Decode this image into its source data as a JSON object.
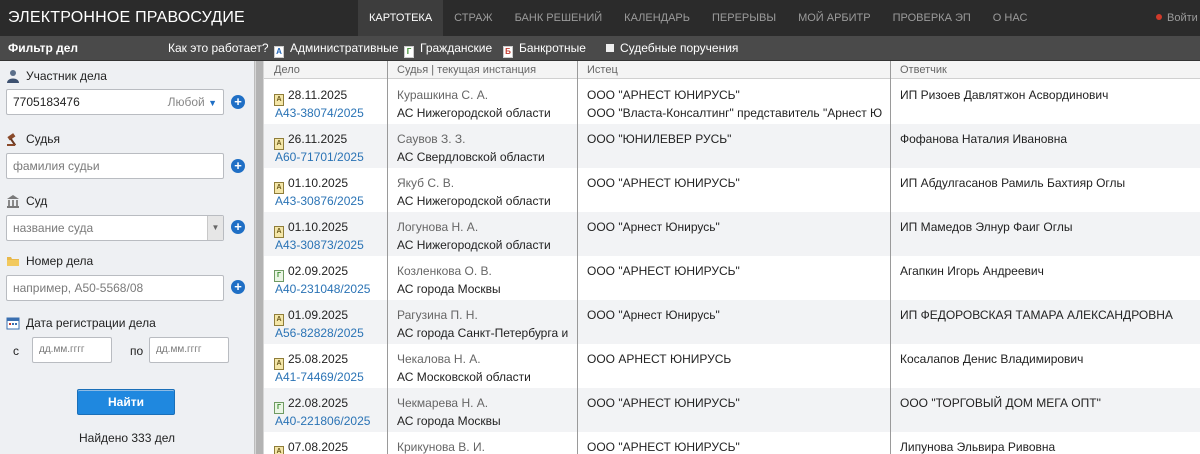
{
  "app": {
    "logo": "ЭЛЕКТРОННОЕ ПРАВОСУДИЕ",
    "nav": [
      "КАРТОТЕКА",
      "СТРАЖ",
      "БАНК РЕШЕНИЙ",
      "КАЛЕНДАРЬ",
      "ПЕРЕРЫВЫ",
      "МОЙ АРБИТР",
      "ПРОВЕРКА ЭП",
      "О НАС"
    ],
    "active_nav": "КАРТОТЕКА",
    "exit_label": "Войти"
  },
  "filterbar": {
    "title": "Фильтр дел",
    "how": "Как это работает?",
    "types": [
      "Административные",
      "Гражданские",
      "Банкротные",
      "Судебные поручения"
    ]
  },
  "sidebar": {
    "participant_label": "Участник дела",
    "participant_value": "7705183476",
    "participant_mode": "Любой",
    "judge_label": "Судья",
    "judge_placeholder": "фамилия судьи",
    "court_label": "Суд",
    "court_placeholder": "название суда",
    "case_number_label": "Номер дела",
    "case_number_placeholder": "например, А50-5568/08",
    "date_label": "Дата регистрации дела",
    "from_label": "с",
    "to_label": "по",
    "date_placeholder": "дд.мм.гггг",
    "find_button": "Найти",
    "found_text": "Найдено 333 дел"
  },
  "table": {
    "columns": [
      "Дело",
      "Судья | текущая инстанция",
      "Истец",
      "Ответчик"
    ],
    "rows": [
      {
        "type": "А",
        "date": "28.11.2025",
        "case": "А43-38074/2025",
        "judge": "Курашкина С. А.",
        "court": "АС Нижегородской области",
        "plaintiff": "ООО \"АРНЕСТ ЮНИРУСЬ\"",
        "plaintiff2": "ООО \"Власта-Консалтинг\" представитель \"Арнест Юнирусь\"",
        "defendant": "ИП Ризоев Давлятжон Асвординович"
      },
      {
        "type": "А",
        "date": "26.11.2025",
        "case": "А60-71701/2025",
        "judge": "Саувов З. З.",
        "court": "АС Свердловской области",
        "plaintiff": "ООО \"ЮНИЛЕВЕР РУСЬ\"",
        "plaintiff2": "",
        "defendant": "Фофанова Наталия Ивановна"
      },
      {
        "type": "А",
        "date": "01.10.2025",
        "case": "А43-30876/2025",
        "judge": "Якуб С. В.",
        "court": "АС Нижегородской области",
        "plaintiff": "ООО \"АРНЕСТ ЮНИРУСЬ\"",
        "plaintiff2": "",
        "defendant": "ИП Абдулгасанов Рамиль Бахтияр Оглы"
      },
      {
        "type": "А",
        "date": "01.10.2025",
        "case": "А43-30873/2025",
        "judge": "Логунова Н. А.",
        "court": "АС Нижегородской области",
        "plaintiff": "ООО \"Арнест Юнирусь\"",
        "plaintiff2": "",
        "defendant": "ИП Мамедов Элнур Фаиг Оглы"
      },
      {
        "type": "Г",
        "date": "02.09.2025",
        "case": "А40-231048/2025",
        "judge": "Козленкова О. В.",
        "court": "АС города Москвы",
        "plaintiff": "ООО \"АРНЕСТ ЮНИРУСЬ\"",
        "plaintiff2": "",
        "defendant": "Агапкин Игорь Андреевич"
      },
      {
        "type": "А",
        "date": "01.09.2025",
        "case": "А56-82828/2025",
        "judge": "Рагузина П. Н.",
        "court": "АС города Санкт-Петербурга и Лен",
        "plaintiff": "ООО \"Арнест Юнирусь\"",
        "plaintiff2": "",
        "defendant": "ИП ФЕДОРОВСКАЯ ТАМАРА АЛЕКСАНДРОВНА"
      },
      {
        "type": "А",
        "date": "25.08.2025",
        "case": "А41-74469/2025",
        "judge": "Чекалова Н. А.",
        "court": "АС Московской области",
        "plaintiff": "ООО АРНЕСТ ЮНИРУСЬ",
        "plaintiff2": "",
        "defendant": "Косалапов Денис Владимирович"
      },
      {
        "type": "Г",
        "date": "22.08.2025",
        "case": "А40-221806/2025",
        "judge": "Чекмарева Н. А.",
        "court": "АС города Москвы",
        "plaintiff": "ООО \"АРНЕСТ ЮНИРУСЬ\"",
        "plaintiff2": "",
        "defendant": "ООО \"ТОРГОВЫЙ ДОМ МЕГА ОПТ\""
      },
      {
        "type": "А",
        "date": "07.08.2025",
        "case": "",
        "judge": "Крикунова В. И.",
        "court": "",
        "plaintiff": "ООО \"АРНЕСТ ЮНИРУСЬ\"",
        "plaintiff2": "",
        "defendant": "Липунова Эльвира Ривовна"
      }
    ]
  },
  "colors": {
    "topbar": "#2b2b2b",
    "filterbar": "#4a4a4a",
    "accent_blue": "#1f88df",
    "link": "#2a73b5"
  }
}
